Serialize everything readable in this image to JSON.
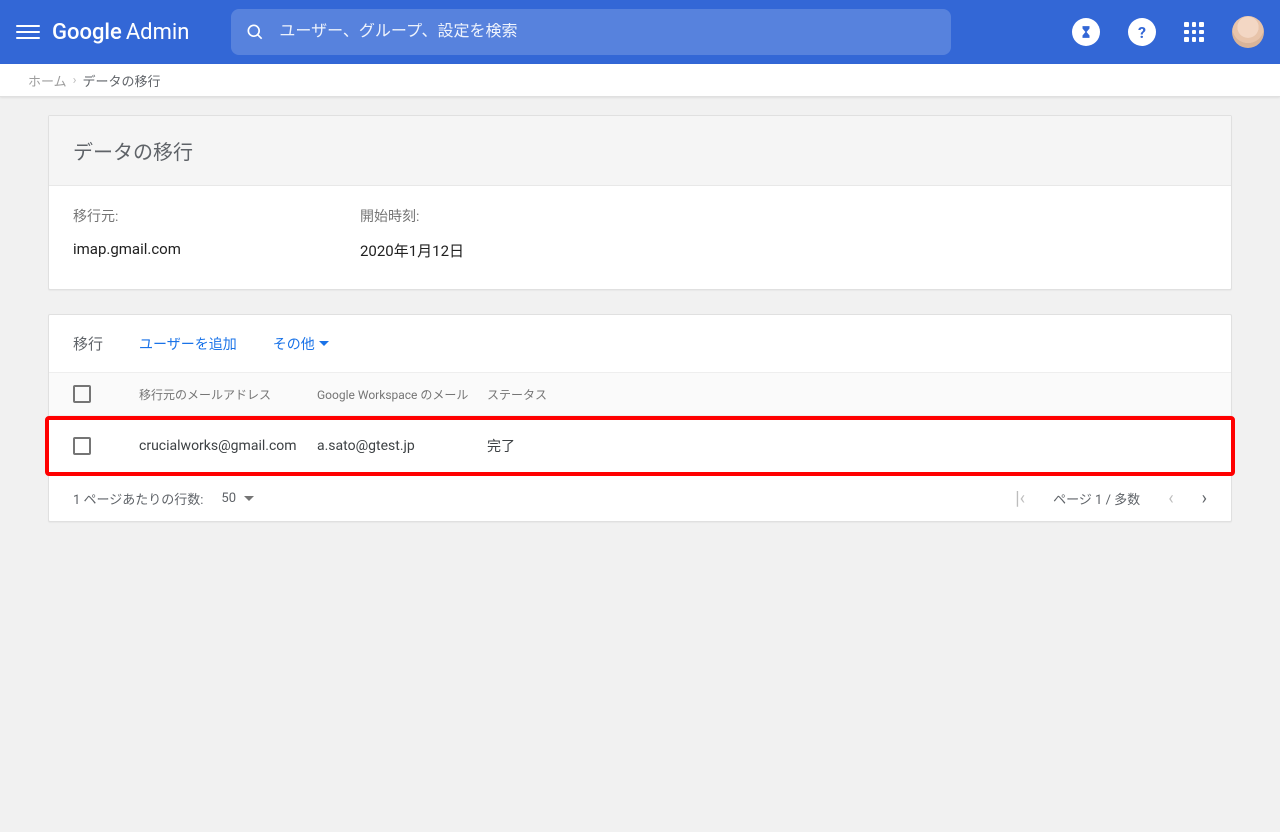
{
  "header": {
    "logo_main": "Google",
    "logo_sub": "Admin",
    "search_placeholder": "ユーザー、グループ、設定を検索"
  },
  "breadcrumb": {
    "home": "ホーム",
    "current": "データの移行"
  },
  "card": {
    "title": "データの移行",
    "source_label": "移行元:",
    "source_value": "imap.gmail.com",
    "start_label": "開始時刻:",
    "start_value": "2020年1月12日"
  },
  "toolbar": {
    "title": "移行",
    "add_user": "ユーザーを追加",
    "more": "その他"
  },
  "columns": {
    "source_email": "移行元のメールアドレス",
    "workspace_email": "Google Workspace のメール",
    "status": "ステータス"
  },
  "rows": [
    {
      "source": "crucialworks@gmail.com",
      "ws": "a.sato@gtest.jp",
      "status": "完了"
    }
  ],
  "pager": {
    "rows_label": "1 ページあたりの行数:",
    "rows_value": "50",
    "page_info": "ページ 1 / 多数"
  }
}
